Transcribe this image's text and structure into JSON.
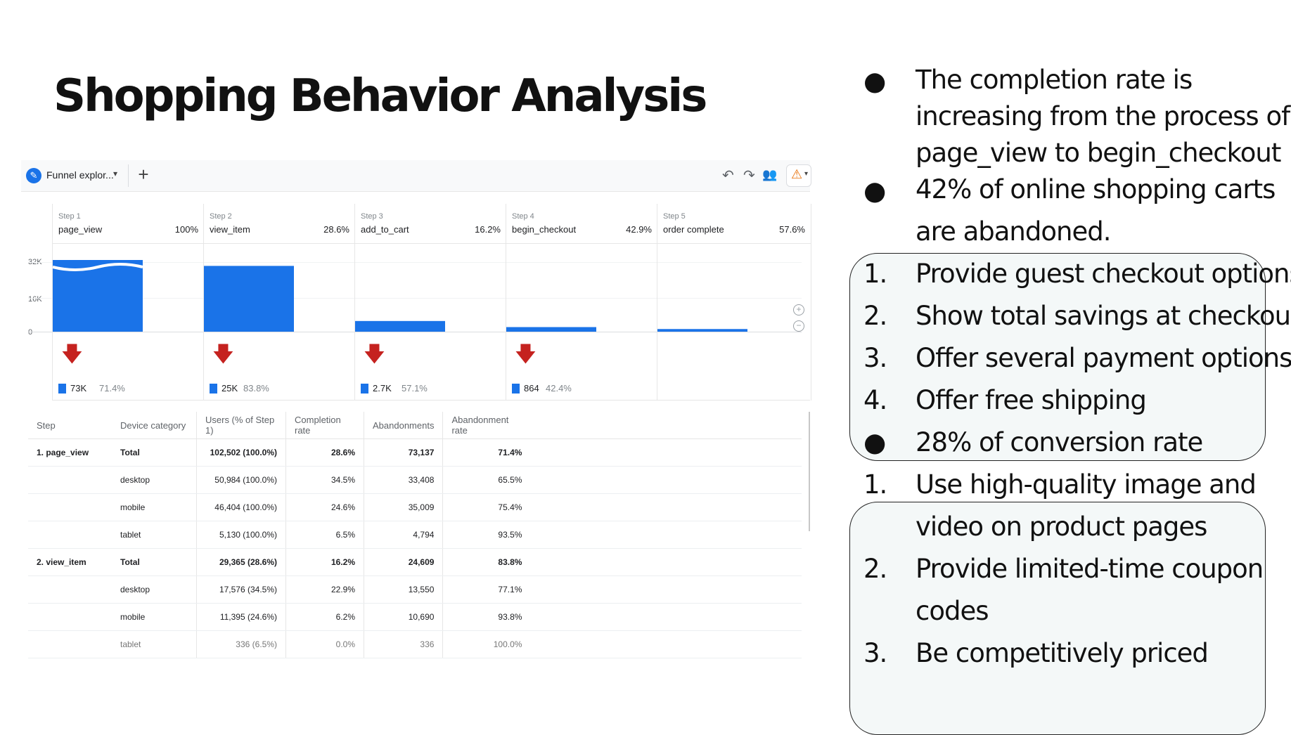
{
  "slide": {
    "title": "Shopping Behavior Analysis"
  },
  "toolbar": {
    "tab_label": "Funnel explor...",
    "tab_caret": "▾",
    "add_tab": "+",
    "undo_icon": "↶",
    "redo_icon": "↷",
    "share_icon": "👥",
    "warning_icon": "⚠",
    "warning_caret": "▾"
  },
  "funnel": {
    "axis_labels": [
      "32K",
      "16K",
      "0"
    ],
    "steps": [
      {
        "num": "Step 1",
        "name": "page_view",
        "pct": "100%",
        "drop_count": "73K",
        "drop_rate": "71.4%"
      },
      {
        "num": "Step 2",
        "name": "view_item",
        "pct": "28.6%",
        "drop_count": "25K",
        "drop_rate": "83.8%"
      },
      {
        "num": "Step 3",
        "name": "add_to_cart",
        "pct": "16.2%",
        "drop_count": "2.7K",
        "drop_rate": "57.1%"
      },
      {
        "num": "Step 4",
        "name": "begin_checkout",
        "pct": "42.9%",
        "drop_count": "864",
        "drop_rate": "42.4%"
      },
      {
        "num": "Step 5",
        "name": "order complete",
        "pct": "57.6%",
        "drop_count": "",
        "drop_rate": ""
      }
    ],
    "zoom_in": "+",
    "zoom_out": "−",
    "drop_arrow": "🡇"
  },
  "chart_data": {
    "type": "bar",
    "title": "",
    "categories": [
      "page_view",
      "view_item",
      "add_to_cart",
      "begin_checkout",
      "order complete"
    ],
    "values": [
      102502,
      29365,
      4756,
      2040,
      1175
    ],
    "value_labels": [
      "100%",
      "28.6%",
      "16.2%",
      "42.9%",
      "57.6%"
    ],
    "ylim": [
      0,
      32000
    ],
    "y_ticks": [
      "0",
      "16K",
      "32K"
    ],
    "bar_color": "#1a73e8",
    "drop_arrow_color": "#c5221f",
    "abandonments": [
      "73K",
      "25K",
      "2.7K",
      "864"
    ],
    "abandonment_rates": [
      "71.4%",
      "83.8%",
      "57.1%",
      "42.4%"
    ]
  },
  "table": {
    "headers": [
      "Step",
      "Device category",
      "Users (% of Step 1)",
      "Completion rate",
      "Abandonments",
      "Abandonment rate"
    ],
    "rows": [
      {
        "step": "1. page_view",
        "device": "Total",
        "users": "102,502 (100.0%)",
        "completion": "28.6%",
        "abandon": "73,137",
        "abandon_rate": "71.4%"
      },
      {
        "step": "",
        "device": "desktop",
        "users": "50,984 (100.0%)",
        "completion": "34.5%",
        "abandon": "33,408",
        "abandon_rate": "65.5%"
      },
      {
        "step": "",
        "device": "mobile",
        "users": "46,404 (100.0%)",
        "completion": "24.6%",
        "abandon": "35,009",
        "abandon_rate": "75.4%"
      },
      {
        "step": "",
        "device": "tablet",
        "users": "5,130 (100.0%)",
        "completion": "6.5%",
        "abandon": "4,794",
        "abandon_rate": "93.5%"
      },
      {
        "step": "2. view_item",
        "device": "Total",
        "users": "29,365 (28.6%)",
        "completion": "16.2%",
        "abandon": "24,609",
        "abandon_rate": "83.8%"
      },
      {
        "step": "",
        "device": "desktop",
        "users": "17,576 (34.5%)",
        "completion": "22.9%",
        "abandon": "13,550",
        "abandon_rate": "77.1%"
      },
      {
        "step": "",
        "device": "mobile",
        "users": "11,395 (24.6%)",
        "completion": "6.2%",
        "abandon": "10,690",
        "abandon_rate": "93.8%"
      },
      {
        "step": "",
        "device": "tablet",
        "users": "336 (6.5%)",
        "completion": "0.0%",
        "abandon": "336",
        "abandon_rate": "100.0%"
      }
    ]
  },
  "panel": {
    "bullet_mark": "●",
    "b1_lines": [
      "The completion rate is",
      "increasing from the process of",
      "page_view to begin_checkout"
    ],
    "b2_lines": [
      "42% of online shopping carts",
      "are abandoned."
    ],
    "list1": [
      {
        "num": "1.",
        "text": "Provide guest checkout options"
      },
      {
        "num": "2.",
        "text": "Show total savings at checkout"
      },
      {
        "num": "3.",
        "text": "Offer several payment options"
      },
      {
        "num": "4.",
        "text": "Offer free shipping"
      }
    ],
    "b3": "28% of conversion rate",
    "list2": [
      {
        "num": "1.",
        "lines": [
          "Use high-quality image and",
          "video on product pages"
        ]
      },
      {
        "num": "2.",
        "lines": [
          "Provide limited-time coupon",
          "codes"
        ]
      },
      {
        "num": "3.",
        "lines": [
          "Be competitively priced"
        ]
      }
    ]
  }
}
